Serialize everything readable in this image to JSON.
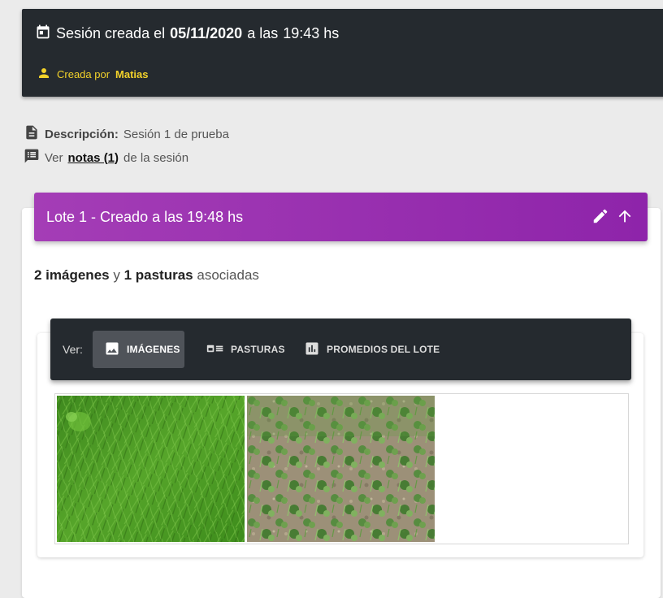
{
  "session": {
    "title_prefix": "Sesión creada el",
    "date": "05/11/2020",
    "time_prefix": "a las",
    "time": "19:43 hs",
    "author_prefix": "Creada por",
    "author": "Matias"
  },
  "description": {
    "label": "Descripción:",
    "value": "Sesión 1 de prueba"
  },
  "notes": {
    "prefix": "Ver",
    "link_label": "notas (1)",
    "suffix": "de la sesión"
  },
  "lote": {
    "title": "Lote 1 - Creado a las 19:48 hs",
    "images_count": "2 imágenes",
    "connector": "y",
    "pasturas_count": "1 pasturas",
    "suffix": "asociadas"
  },
  "tabs": {
    "label": "Ver:",
    "items": [
      {
        "label": "IMÁGENES",
        "icon": "image-icon",
        "active": true
      },
      {
        "label": "PASTURAS",
        "icon": "list-icon",
        "active": false
      },
      {
        "label": "PROMEDIOS DEL LOTE",
        "icon": "bar-chart-icon",
        "active": false
      }
    ]
  },
  "colors": {
    "header_dark": "#252a2f",
    "author_yellow": "#f3d22a",
    "lote_purple": "#9c27b0"
  }
}
